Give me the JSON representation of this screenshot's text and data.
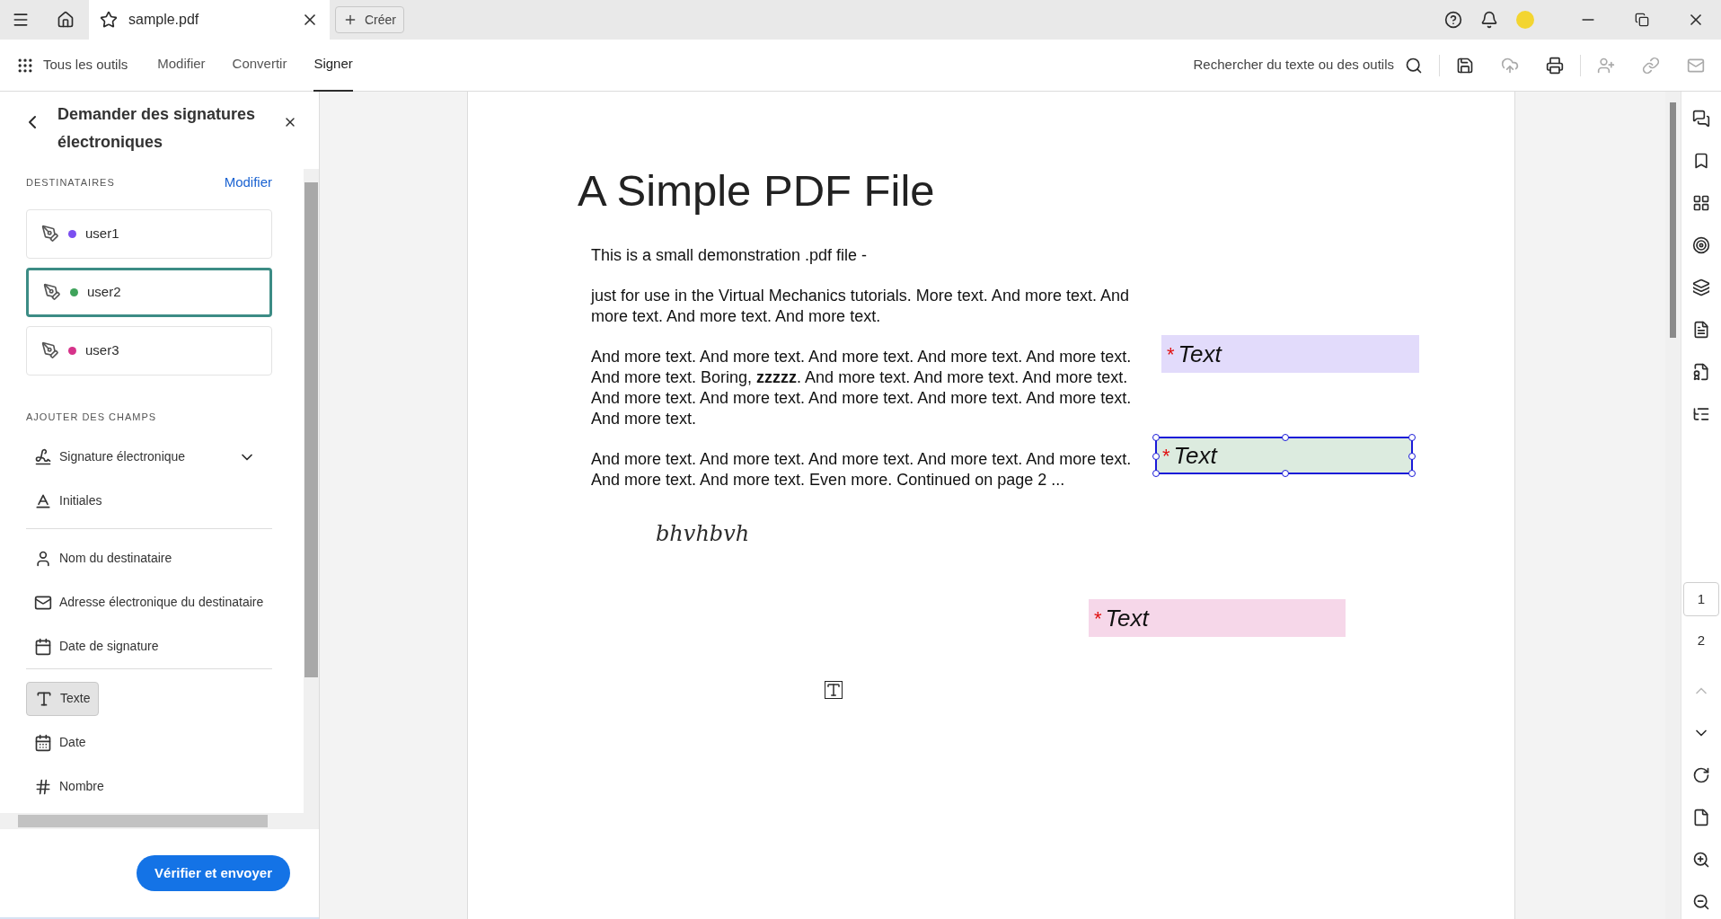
{
  "tab_bar": {
    "tabs": [
      {
        "label": "sample.pdf",
        "selected": true
      }
    ],
    "create_button": "Créer"
  },
  "toolbar": {
    "all_tools": "Tous les outils",
    "menu": [
      {
        "label": "Modifier",
        "selected": false
      },
      {
        "label": "Convertir",
        "selected": false
      },
      {
        "label": "Signer",
        "selected": true
      }
    ],
    "search_label": "Rechercher du texte ou des outils"
  },
  "panel": {
    "title": "Demander des signatures électroniques",
    "recipients_heading": "DESTINATAIRES",
    "recipients_action": "Modifier",
    "recipients": [
      {
        "name": "user1",
        "color": "#7b4ff0",
        "selected": false
      },
      {
        "name": "user2",
        "color": "#3fa35b",
        "selected": true
      },
      {
        "name": "user3",
        "color": "#d6338a",
        "selected": false
      }
    ],
    "fields_heading": "AJOUTER DES CHAMPS",
    "field_groups": [
      [
        {
          "kind": "signature",
          "label": "Signature électronique",
          "dropdown": true,
          "selected": false
        },
        {
          "kind": "initials",
          "label": "Initiales",
          "dropdown": false,
          "selected": false
        }
      ],
      [
        {
          "kind": "person",
          "label": "Nom du destinataire",
          "dropdown": false,
          "selected": false
        },
        {
          "kind": "mail",
          "label": "Adresse électronique du destinataire",
          "dropdown": false,
          "selected": false
        },
        {
          "kind": "signdate",
          "label": "Date de signature",
          "dropdown": false,
          "selected": false
        }
      ],
      [
        {
          "kind": "text",
          "label": "Texte",
          "dropdown": false,
          "selected": true
        },
        {
          "kind": "date",
          "label": "Date",
          "dropdown": false,
          "selected": false
        },
        {
          "kind": "number",
          "label": "Nombre",
          "dropdown": false,
          "selected": false
        }
      ]
    ],
    "submit_button": "Vérifier et envoyer"
  },
  "document": {
    "title": "A Simple PDF File",
    "paragraphs": [
      "This is a small demonstration .pdf file -",
      "just for use in the Virtual Mechanics tutorials. More text. And more text. And more text. And more text. And more text.",
      "And more text. And more text. And more text. And more text. And more text. And more text. Boring, **zzzzz**. And more text. And more text. And more text. And more text. And more text. And more text. And more text. And more text. And more text.",
      "And more text. And more text. And more text. And more text. And more text. And more text. And more text. Even more. Continued on page 2 ..."
    ],
    "signature": "bhvhbvh",
    "fields": [
      {
        "marker": "*",
        "label": "Text",
        "color": "#e2dbfb",
        "selected": false
      },
      {
        "marker": "*",
        "label": "Text",
        "color": "#dcebdf",
        "selected": true
      },
      {
        "marker": "*",
        "label": "Text",
        "color": "#f6d7e9",
        "selected": false
      }
    ]
  },
  "page_nav": {
    "pages": [
      {
        "label": "1",
        "selected": true
      },
      {
        "label": "2",
        "selected": false
      }
    ]
  }
}
